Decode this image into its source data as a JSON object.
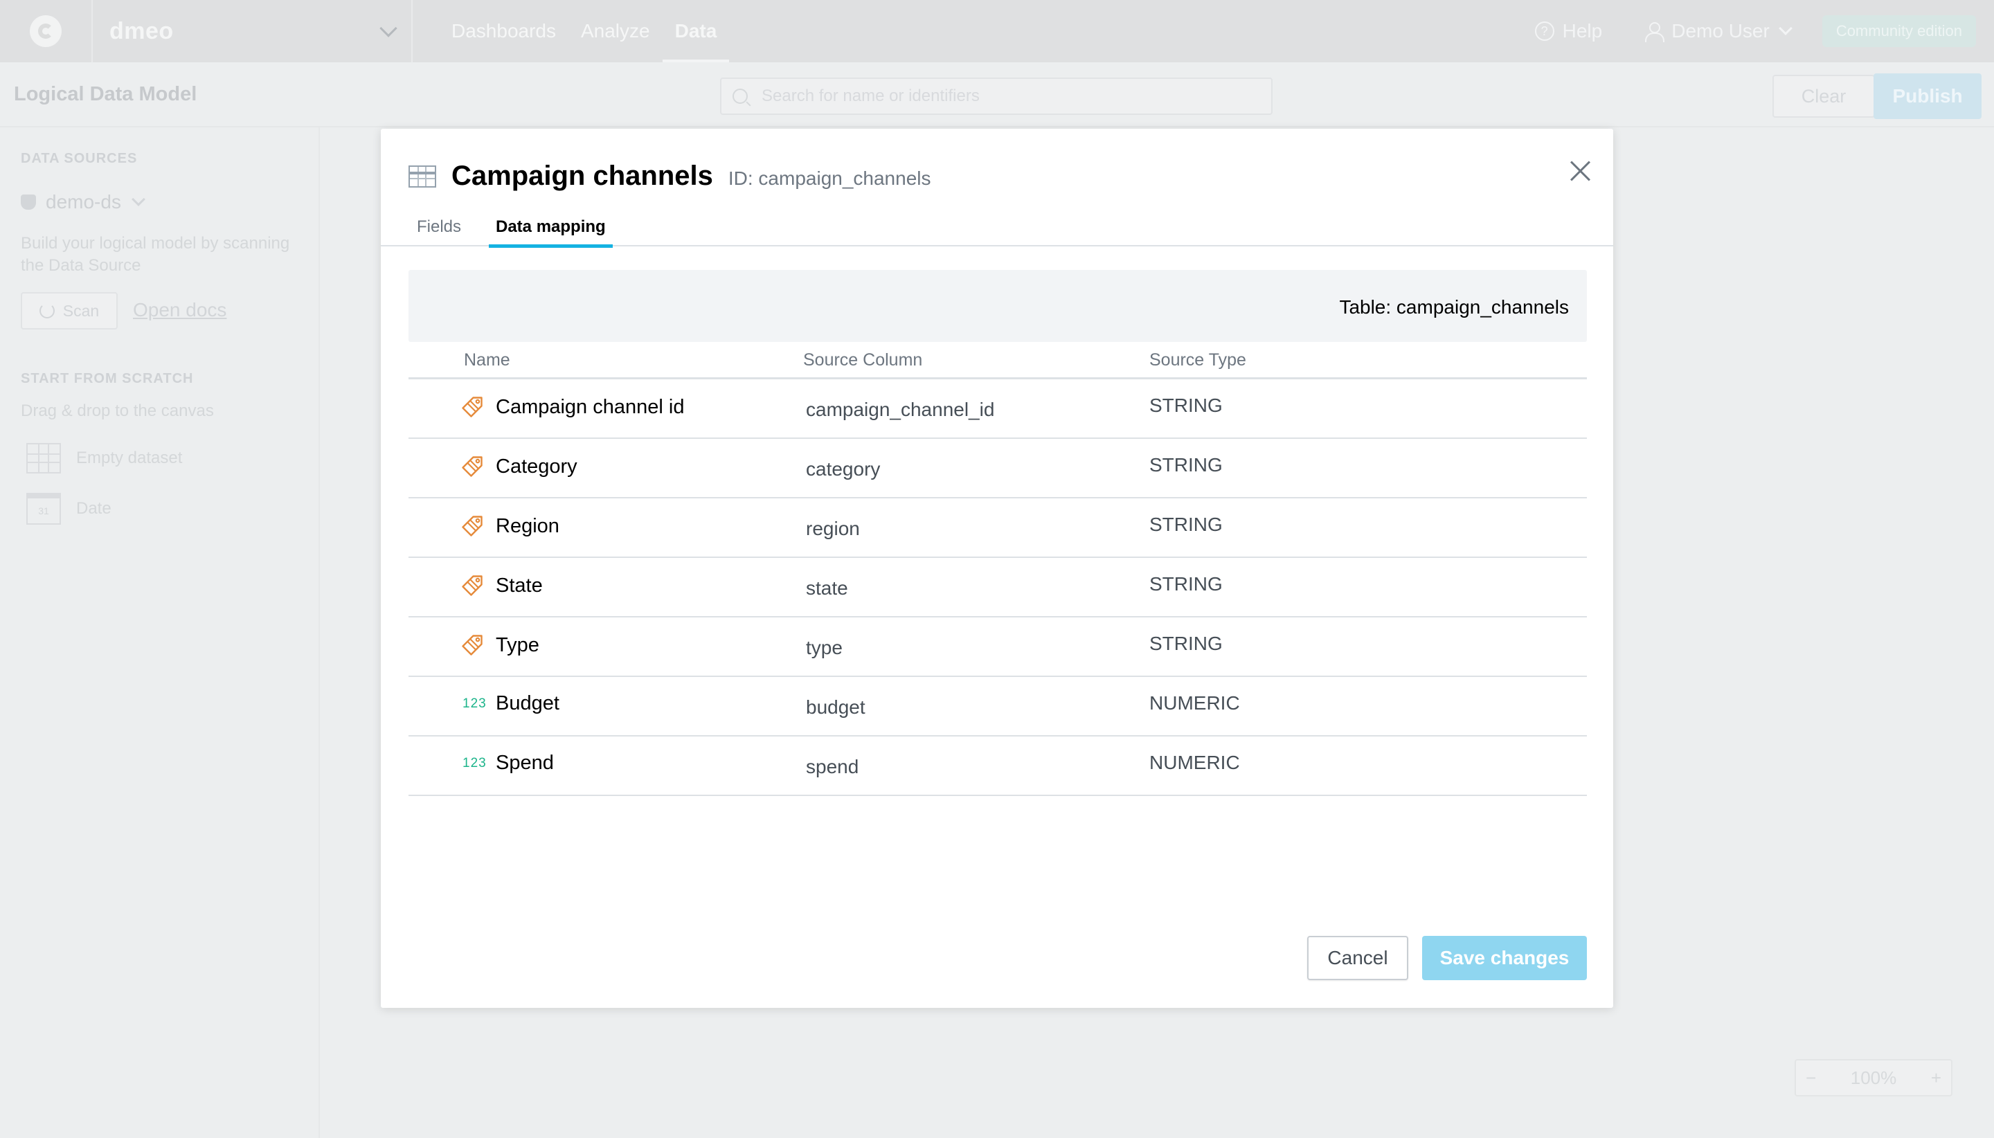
{
  "topbar": {
    "workspace": "dmeo",
    "nav": [
      "Dashboards",
      "Analyze",
      "Data"
    ],
    "help": "Help",
    "user": "Demo User",
    "edition": "Community edition"
  },
  "subheader": {
    "title": "Logical Data Model",
    "search_placeholder": "Search for name or identifiers",
    "clear": "Clear",
    "publish": "Publish"
  },
  "sidebar": {
    "data_sources_heading": "DATA SOURCES",
    "data_source": "demo-ds",
    "scan_hint": "Build your logical model by scanning the Data Source",
    "scan": "Scan",
    "open_docs": "Open docs",
    "scratch_heading": "START FROM SCRATCH",
    "scratch_hint": "Drag & drop to the canvas",
    "empty_dataset": "Empty dataset",
    "date": "Date",
    "date_icon_text": "31"
  },
  "zoom": {
    "minus": "−",
    "level": "100%",
    "plus": "+"
  },
  "modal": {
    "title": "Campaign channels",
    "id": "ID: campaign_channels",
    "tabs": [
      "Fields",
      "Data mapping"
    ],
    "active_tab": "Data mapping",
    "table_label": "Table:  campaign_channels",
    "columns": [
      "Name",
      "Source Column",
      "Source Type"
    ],
    "rows": [
      {
        "icon": "attribute-tag-icon",
        "name": "Campaign channel id",
        "source_column": "campaign_channel_id",
        "source_type": "STRING"
      },
      {
        "icon": "attribute-tag-icon",
        "name": "Category",
        "source_column": "category",
        "source_type": "STRING"
      },
      {
        "icon": "attribute-tag-icon",
        "name": "Region",
        "source_column": "region",
        "source_type": "STRING"
      },
      {
        "icon": "attribute-tag-icon",
        "name": "State",
        "source_column": "state",
        "source_type": "STRING"
      },
      {
        "icon": "attribute-tag-icon",
        "name": "Type",
        "source_column": "type",
        "source_type": "STRING"
      },
      {
        "icon": "numeric-fact-icon",
        "icon_text": "123",
        "name": "Budget",
        "source_column": "budget",
        "source_type": "NUMERIC"
      },
      {
        "icon": "numeric-fact-icon",
        "icon_text": "123",
        "name": "Spend",
        "source_column": "spend",
        "source_type": "NUMERIC"
      }
    ],
    "cancel": "Cancel",
    "save": "Save changes"
  },
  "colors": {
    "accent": "#14b2e2",
    "save_button": "#8fd6f0",
    "attribute_icon": "#e58a3a",
    "numeric_icon": "#1cb48a"
  }
}
